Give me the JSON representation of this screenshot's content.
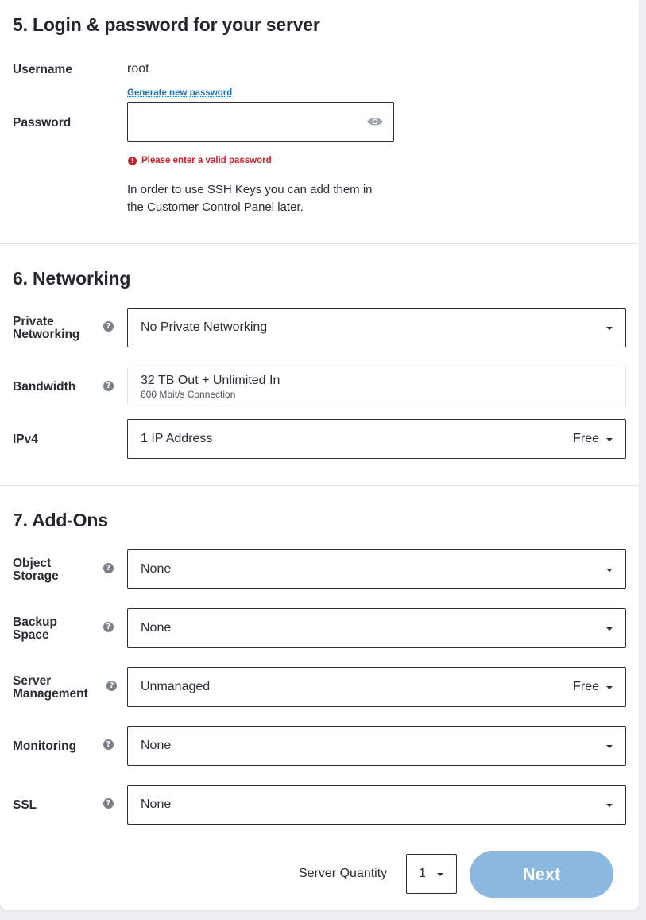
{
  "login": {
    "heading": "5. Login & password for your server",
    "username_label": "Username",
    "username_value": "root",
    "generate_link": "Generate new password",
    "password_label": "Password",
    "password_value": "",
    "error_text": "Please enter a valid password",
    "ssh_note_line1": "In order to use SSH Keys you can add them in",
    "ssh_note_line2": "the Customer Control Panel later."
  },
  "networking": {
    "heading": "6. Networking",
    "private_label_1": "Private",
    "private_label_2": "Networking",
    "private_value": "No Private Networking",
    "bandwidth_label": "Bandwidth",
    "bandwidth_value": "32 TB Out + Unlimited In",
    "bandwidth_sub": "600 Mbit/s Connection",
    "ipv4_label": "IPv4",
    "ipv4_value": "1 IP Address",
    "ipv4_price": "Free"
  },
  "addons": {
    "heading": "7. Add-Ons",
    "object_label_1": "Object",
    "object_label_2": "Storage",
    "object_value": "None",
    "backup_label_1": "Backup",
    "backup_label_2": "Space",
    "backup_value": "None",
    "mgmt_label_1": "Server",
    "mgmt_label_2": "Management",
    "mgmt_value": "Unmanaged",
    "mgmt_price": "Free",
    "monitoring_label": "Monitoring",
    "monitoring_value": "None",
    "ssl_label": "SSL",
    "ssl_value": "None"
  },
  "footer": {
    "quantity_label": "Server Quantity",
    "quantity_value": "1",
    "next_label": "Next"
  },
  "icons": {
    "help": "?",
    "error": "!"
  },
  "colors": {
    "accent_disabled": "#8ab8df",
    "error": "#c8232c",
    "link": "#1f6fb4"
  }
}
